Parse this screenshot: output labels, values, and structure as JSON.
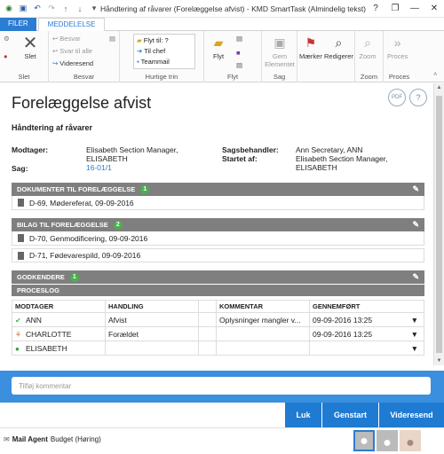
{
  "window": {
    "title": "Håndtering af råvarer (Forelæggelse afvist) - KMD SmartTask (Almindelig tekst)",
    "quick_access": [
      "save-icon",
      "undo-icon",
      "redo-icon",
      "up-arrow-icon",
      "down-arrow-icon",
      "more-icon"
    ],
    "controls": {
      "help": "?",
      "restore": "❐",
      "minimize": "—",
      "close": "✕"
    }
  },
  "tabs": {
    "file": "FILER",
    "message": "MEDDELELSE"
  },
  "ribbon": {
    "delete": {
      "label": "Slet",
      "group": "Slet"
    },
    "reply": {
      "items": [
        "Besvar",
        "Svar til alle",
        "Videresend"
      ],
      "group": "Besvar"
    },
    "quicksteps": {
      "items": [
        "Flyt til: ?",
        "Til chef",
        "Teammail"
      ],
      "group": "Hurtige trin"
    },
    "move": {
      "label": "Flyt",
      "group": "Flyt"
    },
    "save": {
      "label": "Gem Elementet",
      "group": "Sag"
    },
    "tags": {
      "label": "Mærker"
    },
    "edit": {
      "label": "Redigerer"
    },
    "zoom": {
      "label": "Zoom",
      "group": "Zoom"
    },
    "process": {
      "label": "Proces",
      "group": "Proces"
    }
  },
  "document": {
    "title": "Forelæggelse afvist",
    "subtitle": "Håndtering af råvarer",
    "pdf_label": "PDF",
    "help": "?",
    "fields": {
      "modtager_label": "Modtager:",
      "modtager_value": "Elisabeth Section Manager, ELISABETH",
      "sag_label": "Sag:",
      "sag_value": "16-01/1",
      "sagsbehandler_label": "Sagsbehandler:",
      "sagsbehandler_value": "Ann Secretary, ANN",
      "startet_label": "Startet af:",
      "startet_value": "Elisabeth Section Manager, ELISABETH"
    },
    "sections": {
      "documents": {
        "title": "DOKUMENTER TIL FORELÆGGELSE",
        "count": "1",
        "items": [
          "D-69, Mødereferat, 09-09-2016"
        ]
      },
      "attachments": {
        "title": "BILAG TIL FORELÆGGELSE",
        "count": "2",
        "items": [
          "D-70, Genmodificering, 09-09-2016",
          "D-71, Fødevarespild, 09-09-2016"
        ]
      },
      "approvers": {
        "title": "GODKENDERE",
        "count": "1"
      },
      "processlog": {
        "title": "PROCESLOG",
        "headers": [
          "MODTAGER",
          "HANDLING",
          "",
          "KOMMENTAR",
          "GENNEMFØRT"
        ],
        "rows": [
          {
            "name": "ANN",
            "action": "Afvist",
            "comment": "Oplysninger mangler v...",
            "done": "09-09-2016 13:25",
            "icon_color": "#4caf50"
          },
          {
            "name": "CHARLOTTE",
            "action": "Forældet",
            "comment": "",
            "done": "09-09-2016 13:25",
            "icon_color": "#c77d3a"
          },
          {
            "name": "ELISABETH",
            "action": "",
            "comment": "",
            "done": "",
            "icon_color": "#2e9d4a"
          }
        ]
      }
    }
  },
  "comment_placeholder": "Tilføj kommentar",
  "buttons": {
    "close": "Luk",
    "restart": "Genstart",
    "forward": "Videresend"
  },
  "footer": {
    "app": "Mail Agent",
    "context": "Budget (Høring)"
  },
  "colors": {
    "accent": "#2b7cd3",
    "action_blue": "#1f7bd2",
    "comment_bar": "#3a8fde",
    "section_gray": "#7f7f7f",
    "badge_green": "#4caf50"
  }
}
